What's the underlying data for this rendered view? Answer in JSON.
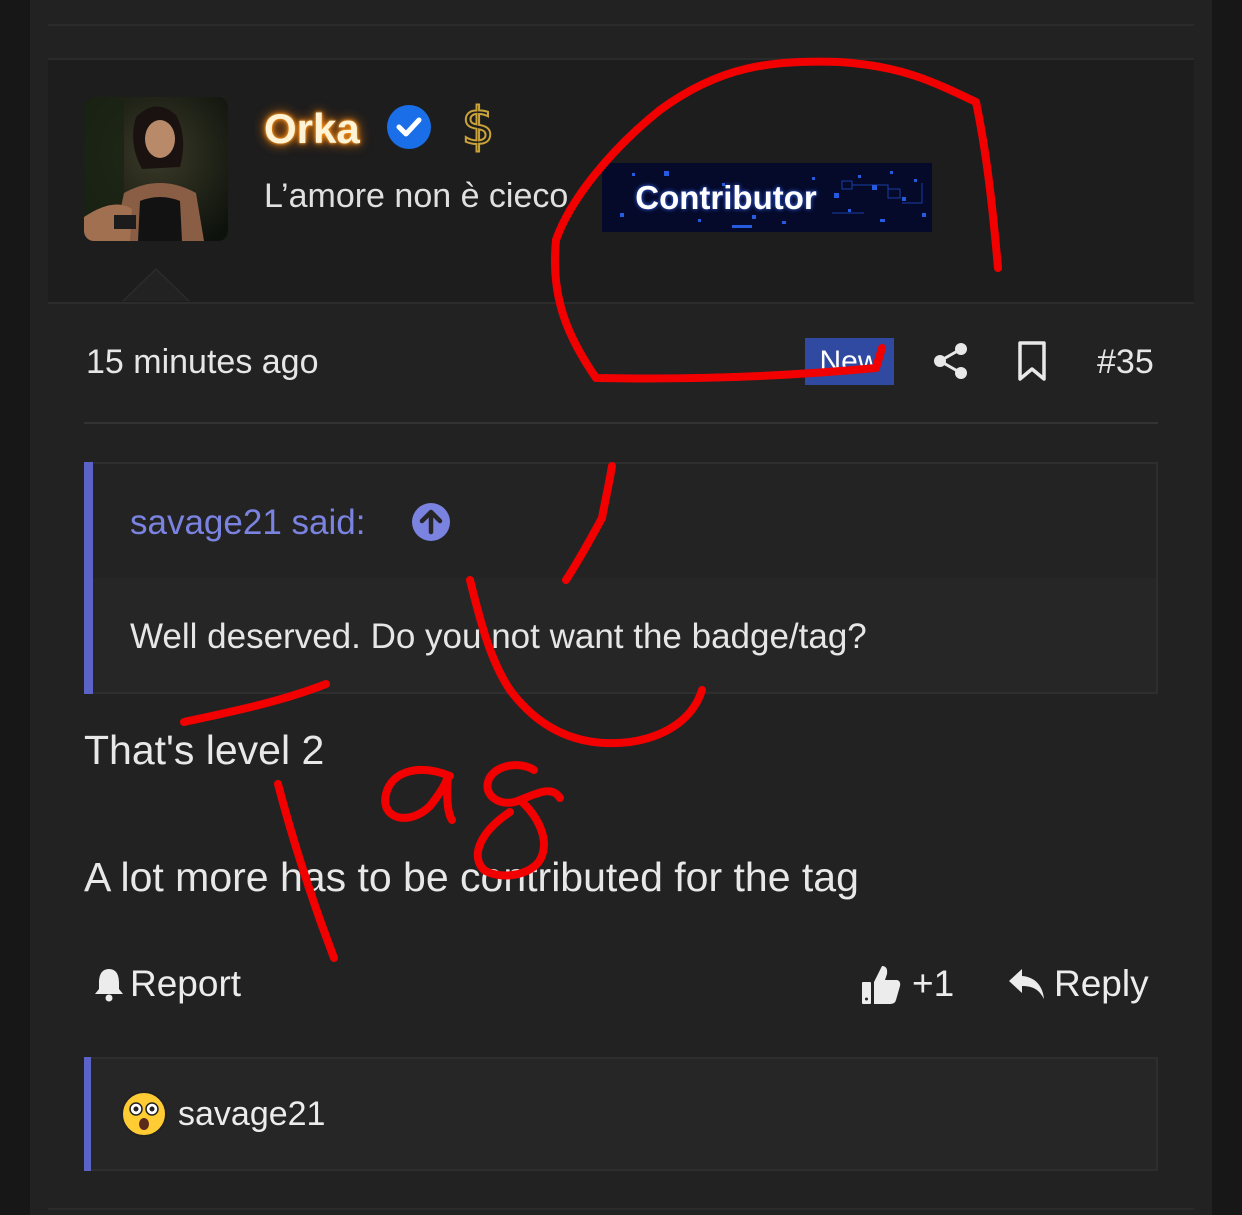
{
  "post": {
    "username": "Orka",
    "user_title": "L’amore non è cieco",
    "banner": "Contributor",
    "time": "15 minutes ago",
    "new_badge": "New",
    "post_number": "#35"
  },
  "quote": {
    "author": "savage21 said:",
    "text": "Well deserved. Do you not want the badge/tag?"
  },
  "body": {
    "line1": "That's level 2",
    "line2": "A lot more has to be contributed for the tag"
  },
  "actions": {
    "report": "Report",
    "like": "+1",
    "reply": "Reply"
  },
  "reactions": {
    "user": "savage21"
  },
  "colors": {
    "background": "#222222",
    "accent": "#5b63c7",
    "new_badge": "#2f4aa0",
    "verified": "#1a6fe8",
    "annotation": "#ff0000",
    "username_glow": "#ff7a00"
  },
  "icons": [
    "verified-icon",
    "dollar-icon",
    "share-icon",
    "bookmark-icon",
    "arrow-up-circle-icon",
    "bell-icon",
    "thumbs-up-icon",
    "reply-icon",
    "astonished-emoji-icon"
  ]
}
